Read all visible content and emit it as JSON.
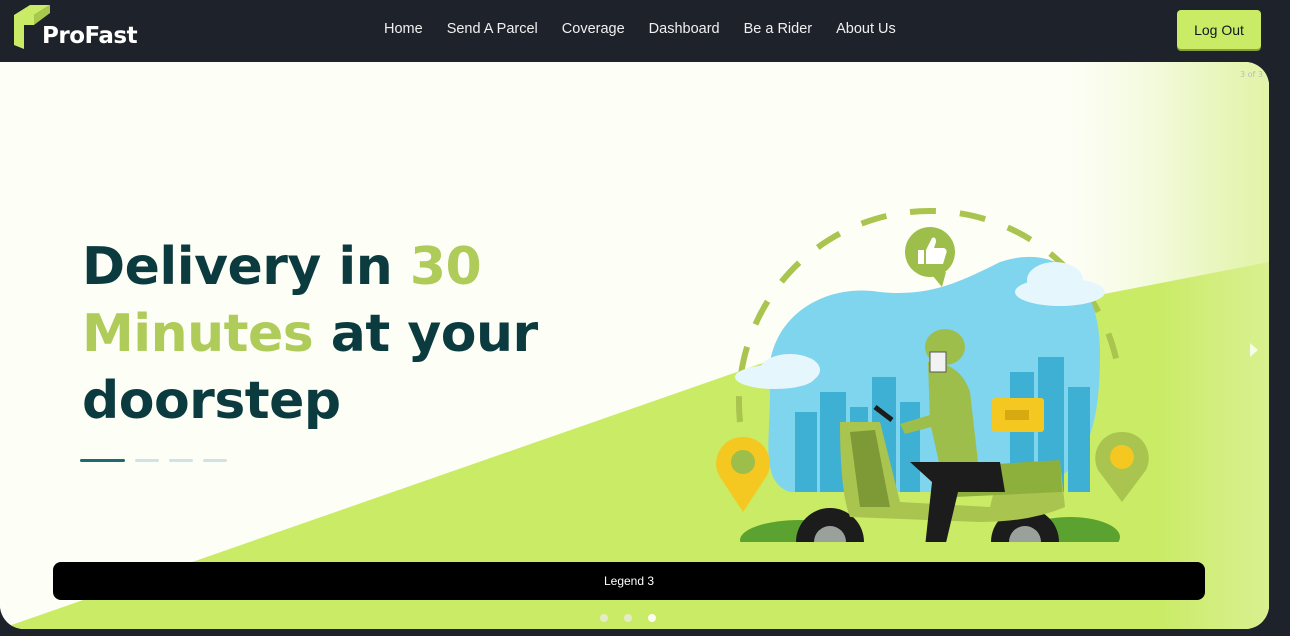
{
  "brand": {
    "name": "ProFast"
  },
  "nav": {
    "links": [
      "Home",
      "Send A Parcel",
      "Coverage",
      "Dashboard",
      "Be a Rider",
      "About Us"
    ],
    "logout_label": "Log Out"
  },
  "carousel": {
    "counter": "3 of 3",
    "headline": {
      "part1": "Delivery in ",
      "accent1": "30",
      "accent2": "Minutes",
      "part2": " at your",
      "part3": "doorstep"
    },
    "legend": "Legend 3",
    "total_slides": 3,
    "active_slide": 3
  },
  "colors": {
    "background": "#1e222a",
    "accent": "#caeb66",
    "headline": "#0b3b3f",
    "headline_accent": "#afcb5a",
    "legend_bg": "#000000"
  },
  "icons": [
    "logo-icon",
    "thumbs-up-icon",
    "location-pin-icon",
    "next-arrow-icon"
  ]
}
